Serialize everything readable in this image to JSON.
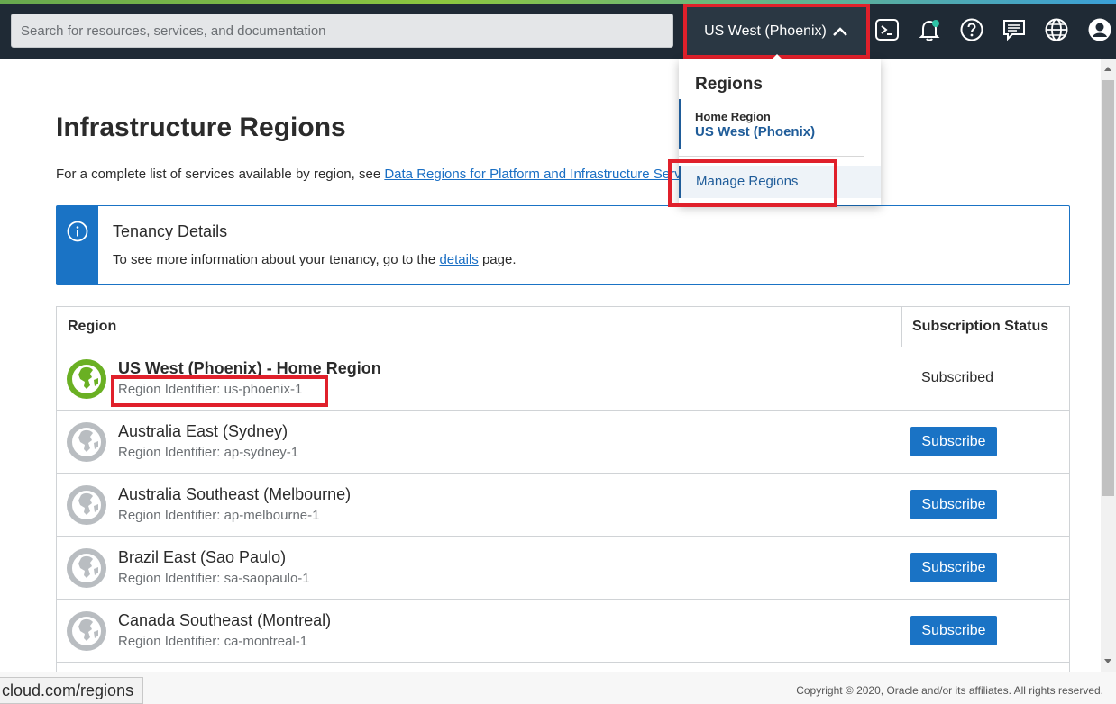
{
  "colors": {
    "accent": "#1a73c5",
    "nav_bg": "#1f2a35",
    "highlight": "#e0202b",
    "home_green": "#6ab023"
  },
  "header": {
    "search_placeholder": "Search for resources, services, and documentation",
    "region_selector": "US West (Phoenix)",
    "icons": [
      "cloud-shell-icon",
      "bell-icon",
      "help-icon",
      "chat-icon",
      "globe-icon",
      "user-avatar-icon"
    ]
  },
  "region_menu": {
    "title": "Regions",
    "home_label": "Home Region",
    "home_value": "US West (Phoenix)",
    "manage": "Manage Regions"
  },
  "page": {
    "title": "Infrastructure Regions",
    "description_prefix": "For a complete list of services available by region, see",
    "description_link": "Data Regions for Platform and Infrastructure Services"
  },
  "info": {
    "title": "Tenancy Details",
    "text_prefix": "To see more information about your tenancy, go to the",
    "link": "details",
    "text_suffix": "page."
  },
  "table": {
    "columns": [
      "Region",
      "Subscription Status"
    ],
    "rows": [
      {
        "name": "US West (Phoenix) - Home Region",
        "identifier": "Region Identifier: us-phoenix-1",
        "status": "Subscribed"
      },
      {
        "name": "Australia East (Sydney)",
        "identifier": "Region Identifier: ap-sydney-1",
        "status": "Subscribe"
      },
      {
        "name": "Australia Southeast (Melbourne)",
        "identifier": "Region Identifier: ap-melbourne-1",
        "status": "Subscribe"
      },
      {
        "name": "Brazil East (Sao Paulo)",
        "identifier": "Region Identifier: sa-saopaulo-1",
        "status": "Subscribe"
      },
      {
        "name": "Canada Southeast (Montreal)",
        "identifier": "Region Identifier: ca-montreal-1",
        "status": "Subscribe"
      }
    ]
  },
  "footer": {
    "status_url": "cloud.com/regions",
    "copyright": "Copyright © 2020, Oracle and/or its affiliates. All rights reserved."
  }
}
